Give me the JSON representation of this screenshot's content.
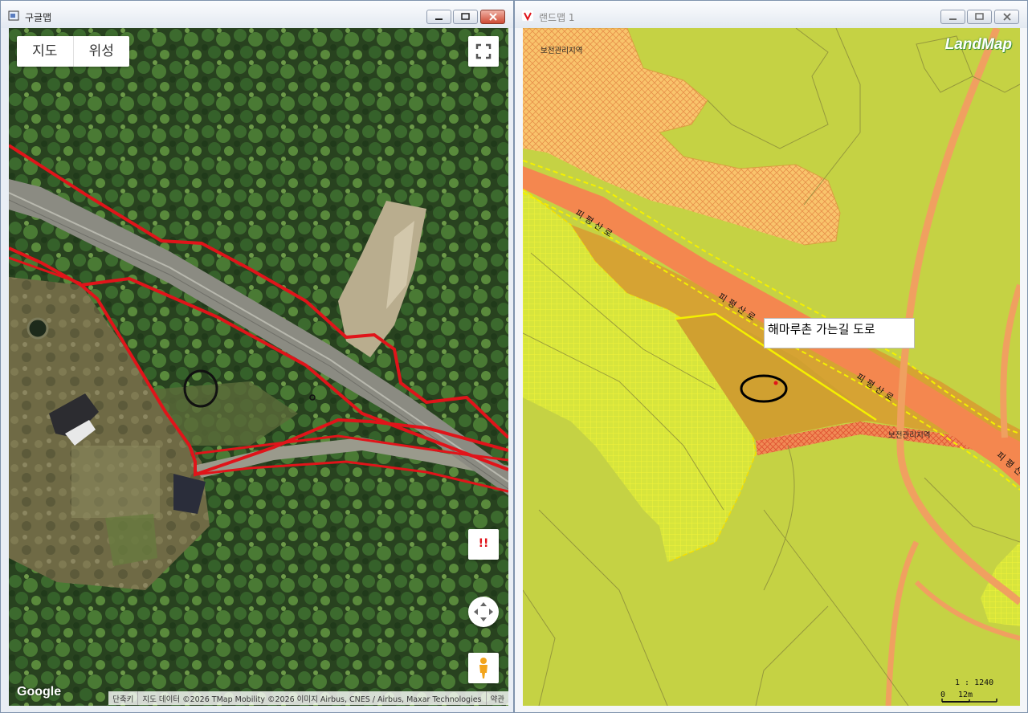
{
  "left_window": {
    "title": "구글맵",
    "map_type_toggle": {
      "map_label": "지도",
      "satellite_label": "위성"
    },
    "google_logo": "Google",
    "footer": {
      "shortcuts": "단축키",
      "attribution": "지도 데이터 ©2026 TMap Mobility ©2026 이미지 Airbus, CNES / Airbus, Maxar Technologies",
      "terms": "약관"
    },
    "report_glyph": "!!",
    "icons": [
      "window-app-icon",
      "fullscreen-icon",
      "report-icon",
      "move-camera-icon",
      "pegman-icon"
    ]
  },
  "right_window": {
    "title": "랜드맵 1",
    "logo": "LandMap",
    "zone_labels": [
      "보전관리지역",
      "보전관리지역"
    ],
    "road_labels": [
      "피평산로",
      "피평산로",
      "피평산로",
      "피평산로"
    ],
    "callout_text": "해마루촌 가는길 도로",
    "scale": {
      "ratio": "1 : 1240",
      "start": "0",
      "end": "12m"
    }
  },
  "colors": {
    "agricultural_green": "#c5d244",
    "conservation_orange": "#f9c46c",
    "road_orange": "#f4874f",
    "parcel_brown": "#d6a333",
    "boundary_red": "#e0141a",
    "window_close_red": "#cf4b35"
  }
}
